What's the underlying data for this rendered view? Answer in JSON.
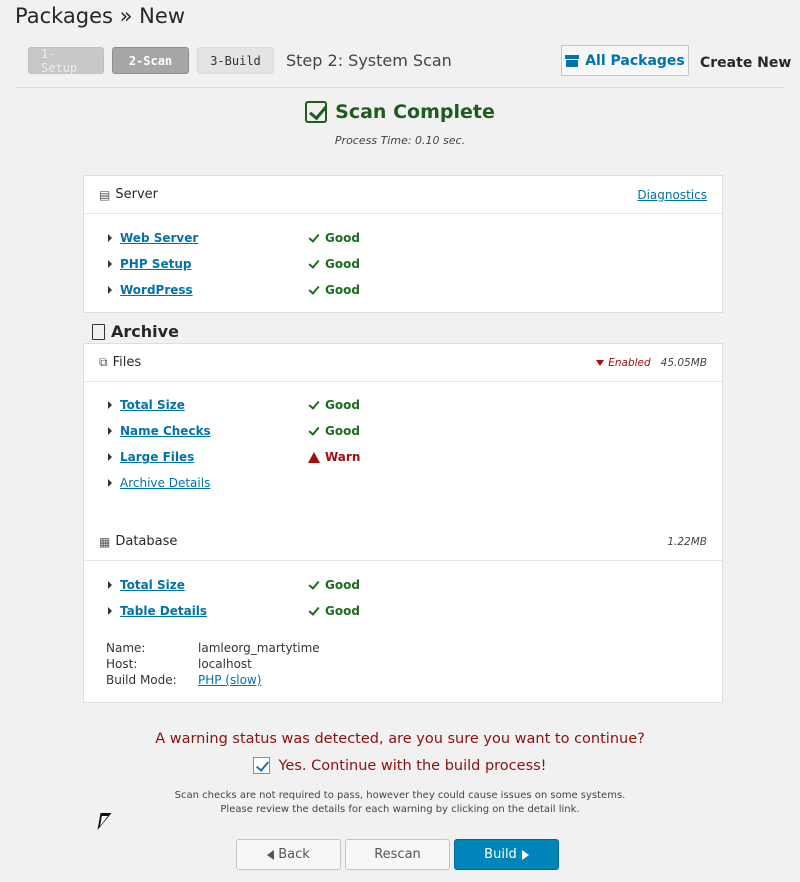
{
  "header": {
    "title": "Packages » New",
    "steps": [
      "1-Setup",
      "2-Scan",
      "3-Build"
    ],
    "step_label": "Step 2: System Scan",
    "all_packages_label": "All Packages",
    "create_new_label": "Create New"
  },
  "scan": {
    "title": "Scan Complete",
    "process_time": "Process Time: 0.10 sec."
  },
  "server": {
    "title": "Server",
    "diagnostics_label": "Diagnostics",
    "rows": [
      {
        "label": "Web Server",
        "status": "Good"
      },
      {
        "label": "PHP Setup",
        "status": "Good"
      },
      {
        "label": "WordPress",
        "status": "Good"
      }
    ]
  },
  "archive": {
    "title": "Archive",
    "files": {
      "title": "Files",
      "filter_label": "Enabled",
      "size": "45.05MB",
      "rows": [
        {
          "label": "Total Size",
          "status": "Good"
        },
        {
          "label": "Name Checks",
          "status": "Good"
        },
        {
          "label": "Large Files",
          "status": "Warn"
        }
      ],
      "details_label": "Archive Details"
    },
    "database": {
      "title": "Database",
      "size": "1.22MB",
      "rows": [
        {
          "label": "Total Size",
          "status": "Good"
        },
        {
          "label": "Table Details",
          "status": "Good"
        }
      ],
      "info": {
        "name_key": "Name:",
        "name_value": "lamleorg_martytime",
        "host_key": "Host:",
        "host_value": "localhost",
        "mode_key": "Build Mode:",
        "mode_value": "PHP (slow)"
      }
    }
  },
  "footer": {
    "warning": "A warning status was detected, are you sure you want to continue?",
    "confirm_label": "Yes. Continue with the build process!",
    "note_line1": "Scan checks are not required to pass, however they could cause issues on some systems.",
    "note_line2": "Please review the details for each warning by clicking on the detail link.",
    "back_label": "Back",
    "rescan_label": "Rescan",
    "build_label": "Build"
  },
  "colors": {
    "accent": "#0073aa",
    "good": "#1e6b1e",
    "warn": "#a01010",
    "primary_button": "#0085ba"
  }
}
